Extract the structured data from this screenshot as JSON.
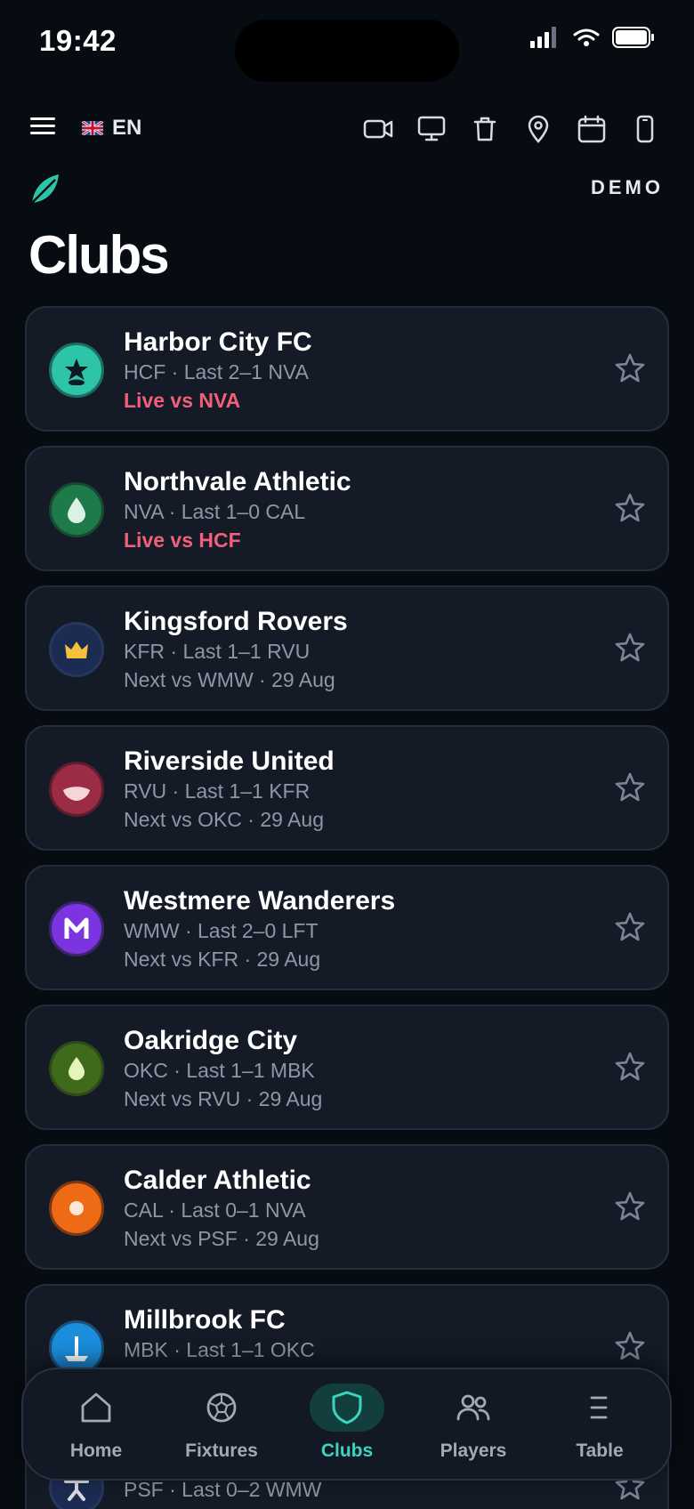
{
  "status_bar": {
    "time": "19:42",
    "icons": [
      "signal-icon",
      "wifi-icon",
      "battery-icon"
    ]
  },
  "toolbar": {
    "language": "EN",
    "flag": "uk-flag-icon",
    "icons": [
      "video-icon",
      "monitor-icon",
      "trash-icon",
      "location-pin-icon",
      "calendar-icon",
      "phone-icon"
    ]
  },
  "header": {
    "badge": "DEMO",
    "title": "Clubs"
  },
  "clubs": [
    {
      "name": "Harbor City FC",
      "meta": "HCF · Last 2–1 NVA",
      "status": "Live vs NVA",
      "live": true,
      "crest_color": "#2ec4a8",
      "crest_border": "#1a6f60",
      "crest_icon": "star-icon"
    },
    {
      "name": "Northvale Athletic",
      "meta": "NVA · Last 1–0 CAL",
      "status": "Live vs HCF",
      "live": true,
      "crest_color": "#1f7a4a",
      "crest_border": "#174a33",
      "crest_icon": "drop-icon"
    },
    {
      "name": "Kingsford Rovers",
      "meta": "KFR · Last 1–1 RVU",
      "status": "Next vs WMW · 29 Aug",
      "live": false,
      "crest_color": "#1c2b52",
      "crest_border": "#26365e",
      "crest_icon": "crown-icon"
    },
    {
      "name": "Riverside United",
      "meta": "RVU · Last 1–1 KFR",
      "status": "Next vs OKC · 29 Aug",
      "live": false,
      "crest_color": "#9c2b45",
      "crest_border": "#5c1d2d",
      "crest_icon": "wave-icon"
    },
    {
      "name": "Westmere Wanderers",
      "meta": "WMW · Last 2–0 LFT",
      "status": "Next vs KFR · 29 Aug",
      "live": false,
      "crest_color": "#7b34e0",
      "crest_border": "#3f2470",
      "crest_icon": "letter-m-icon"
    },
    {
      "name": "Oakridge City",
      "meta": "OKC · Last 1–1 MBK",
      "status": "Next vs RVU · 29 Aug",
      "live": false,
      "crest_color": "#3f6a1c",
      "crest_border": "#2f4a18",
      "crest_icon": "leaf-icon"
    },
    {
      "name": "Calder Athletic",
      "meta": "CAL · Last 0–1 NVA",
      "status": "Next vs PSF · 29 Aug",
      "live": false,
      "crest_color": "#ef6a14",
      "crest_border": "#7c3714",
      "crest_icon": "dot-icon"
    },
    {
      "name": "Millbrook FC",
      "meta": "MBK · Last 1–1 OKC",
      "status": "",
      "live": false,
      "crest_color": "#1b8ddb",
      "crest_border": "#1a4f78",
      "crest_icon": "anchor-icon"
    },
    {
      "name": "",
      "meta": "PSF · Last 0–2 WMW",
      "status": "",
      "live": false,
      "crest_color": "#1c2b52",
      "crest_border": "#26365e",
      "crest_icon": "figure-icon"
    }
  ],
  "tab_bar": {
    "active": "Clubs",
    "tabs": [
      {
        "label": "Home",
        "icon": "home-icon"
      },
      {
        "label": "Fixtures",
        "icon": "ball-icon"
      },
      {
        "label": "Clubs",
        "icon": "shield-icon"
      },
      {
        "label": "Players",
        "icon": "people-icon"
      },
      {
        "label": "Table",
        "icon": "list-icon"
      }
    ]
  },
  "colors": {
    "background": "#070b12",
    "card": "#141b27",
    "accent": "#3bd5bf",
    "live": "#f0607a",
    "muted": "#8f97a6"
  }
}
